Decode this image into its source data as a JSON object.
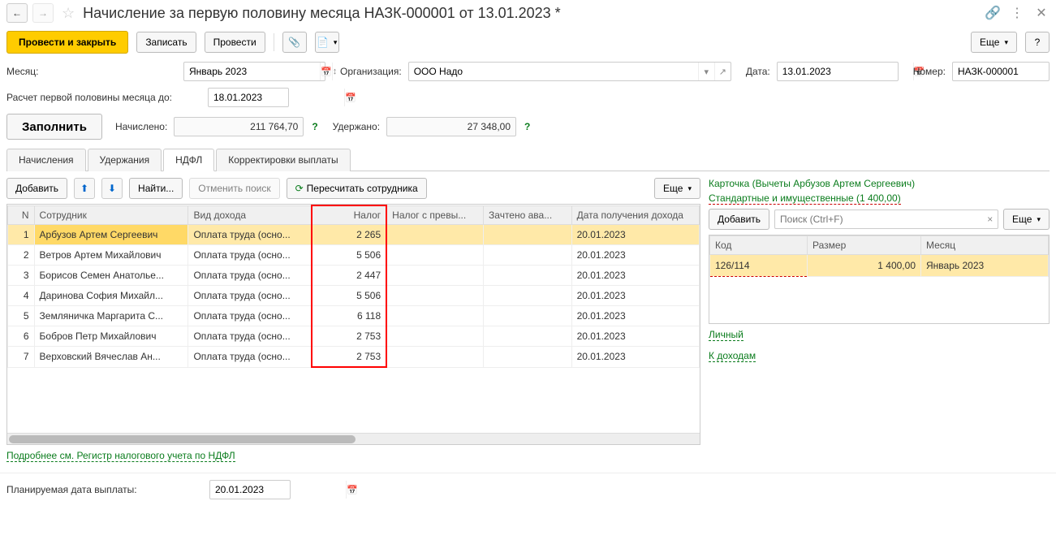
{
  "header": {
    "title": "Начисление за первую половину месяца НАЗК-000001 от 13.01.2023 *"
  },
  "toolbar": {
    "save_close": "Провести и закрыть",
    "save": "Записать",
    "post": "Провести",
    "more": "Еще",
    "help": "?"
  },
  "form": {
    "month_label": "Месяц:",
    "month_value": "Январь 2023",
    "org_label": "Организация:",
    "org_value": "ООО Надо",
    "date_label": "Дата:",
    "date_value": "13.01.2023",
    "number_label": "Номер:",
    "number_value": "НАЗК-000001",
    "calc_until_label": "Расчет первой половины месяца до:",
    "calc_until_value": "18.01.2023",
    "fill": "Заполнить",
    "accrued_label": "Начислено:",
    "accrued_value": "211 764,70",
    "withheld_label": "Удержано:",
    "withheld_value": "27 348,00",
    "planned_date_label": "Планируемая дата выплаты:",
    "planned_date_value": "20.01.2023"
  },
  "tabs": {
    "t1": "Начисления",
    "t2": "Удержания",
    "t3": "НДФЛ",
    "t4": "Корректировки выплаты"
  },
  "subtoolbar": {
    "add": "Добавить",
    "find": "Найти...",
    "cancel_search": "Отменить поиск",
    "recalc": "Пересчитать сотрудника",
    "more": "Еще"
  },
  "cols": {
    "n": "N",
    "emp": "Сотрудник",
    "income": "Вид дохода",
    "tax": "Налог",
    "excess": "Налог с превы...",
    "advance": "Зачтено ава...",
    "date": "Дата получения дохода"
  },
  "rows": [
    {
      "n": "1",
      "emp": "Арбузов Артем Сергеевич",
      "income": "Оплата труда (осно...",
      "tax": "2 265",
      "date": "20.01.2023"
    },
    {
      "n": "2",
      "emp": "Ветров Артем Михайлович",
      "income": "Оплата труда (осно...",
      "tax": "5 506",
      "date": "20.01.2023"
    },
    {
      "n": "3",
      "emp": "Борисов Семен Анатолье...",
      "income": "Оплата труда (осно...",
      "tax": "2 447",
      "date": "20.01.2023"
    },
    {
      "n": "4",
      "emp": "Даринова София Михайл...",
      "income": "Оплата труда (осно...",
      "tax": "5 506",
      "date": "20.01.2023"
    },
    {
      "n": "5",
      "emp": "Земляничка Маргарита С...",
      "income": "Оплата труда (осно...",
      "tax": "6 118",
      "date": "20.01.2023"
    },
    {
      "n": "6",
      "emp": "Бобров Петр Михайлович",
      "income": "Оплата труда (осно...",
      "tax": "2 753",
      "date": "20.01.2023"
    },
    {
      "n": "7",
      "emp": "Верховский Вячеслав Ан...",
      "income": "Оплата труда (осно...",
      "tax": "2 753",
      "date": "20.01.2023"
    }
  ],
  "footer_link": "Подробнее см. Регистр налогового учета по НДФЛ",
  "side": {
    "title": "Карточка (Вычеты Арбузов Артем Сергеевич)",
    "sub": "Стандартные и имущественные (1 400,00)",
    "add": "Добавить",
    "search_ph": "Поиск (Ctrl+F)",
    "more": "Еще",
    "col_code": "Код",
    "col_size": "Размер",
    "col_month": "Месяц",
    "row_code": "126/114",
    "row_size": "1 400,00",
    "row_month": "Январь 2023",
    "link_personal": "Личный",
    "link_income": "К доходам"
  }
}
